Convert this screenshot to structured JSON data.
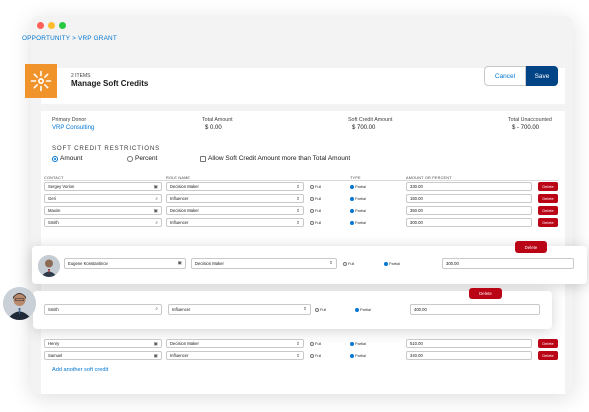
{
  "window": {
    "dot_colors": [
      "#ff5f57",
      "#febc2e",
      "#28c840"
    ]
  },
  "breadcrumb": "OPPORTUNITY > VRP GRANT",
  "header": {
    "item_count": "2 ITEMS",
    "title": "Manage Soft Credits",
    "cancel_label": "Cancel",
    "save_label": "Save",
    "brand_icon": "gear-sunburst-icon"
  },
  "summary": {
    "primary_donor_label": "Primary Donor",
    "primary_donor_value": "VRP Consulting",
    "total_amount_label": "Total Amount",
    "total_amount_value": "$ 0.00",
    "soft_credit_amount_label": "Soft Credit Amount",
    "soft_credit_amount_value": "$ 700.00",
    "total_unaccounted_label": "Total Unaccounted",
    "total_unaccounted_value": "$ - 700.00"
  },
  "restrictions": {
    "title": "SOFT CREDIT RESTRICTIONS",
    "amount_label": "Amount",
    "percent_label": "Percent",
    "allow_label": "Allow Soft Credit Amount more than Total Amount",
    "selected": "Amount"
  },
  "table": {
    "headers": {
      "contact": "CONTACT",
      "role": "ROLE NAME",
      "type": "TYPE",
      "amount": "AMOUNT OR PERCENT"
    },
    "full_label": "Full",
    "partial_label": "Partial",
    "delete_label": "Delete",
    "rows": [
      {
        "contact": "Sergey Vorion",
        "contact_icon": "contact-card-icon",
        "role": "Decision Maker",
        "amount": "330.00"
      },
      {
        "contact": "Geri",
        "contact_icon": "search-icon",
        "role": "Influencer",
        "amount": "150.00"
      },
      {
        "contact": "Maxim",
        "contact_icon": "contact-card-icon",
        "role": "Decision Maker",
        "amount": "350.00"
      },
      {
        "contact": "Smith",
        "contact_icon": "search-icon",
        "role": "Influencer",
        "amount": "300.00"
      }
    ],
    "float_rows": [
      {
        "contact": "Eugene Konstantinov",
        "contact_icon": "contact-card-icon",
        "role": "Decision Maker",
        "amount": "300.00"
      },
      {
        "contact": "Smith",
        "contact_icon": "search-icon",
        "role": "Influencer",
        "amount": "400.00"
      }
    ],
    "bottom_rows": [
      {
        "contact": "Henry",
        "contact_icon": "contact-card-icon",
        "role": "Decision Maker",
        "amount": "510.00"
      },
      {
        "contact": "Samuel",
        "contact_icon": "contact-card-icon",
        "role": "Influencer",
        "amount": "340.00"
      }
    ]
  },
  "add_link": "Add another soft credit",
  "colors": {
    "accent": "#0176d3",
    "save": "#014486",
    "delete": "#ba0517",
    "brand_tile": "#f0932b"
  }
}
